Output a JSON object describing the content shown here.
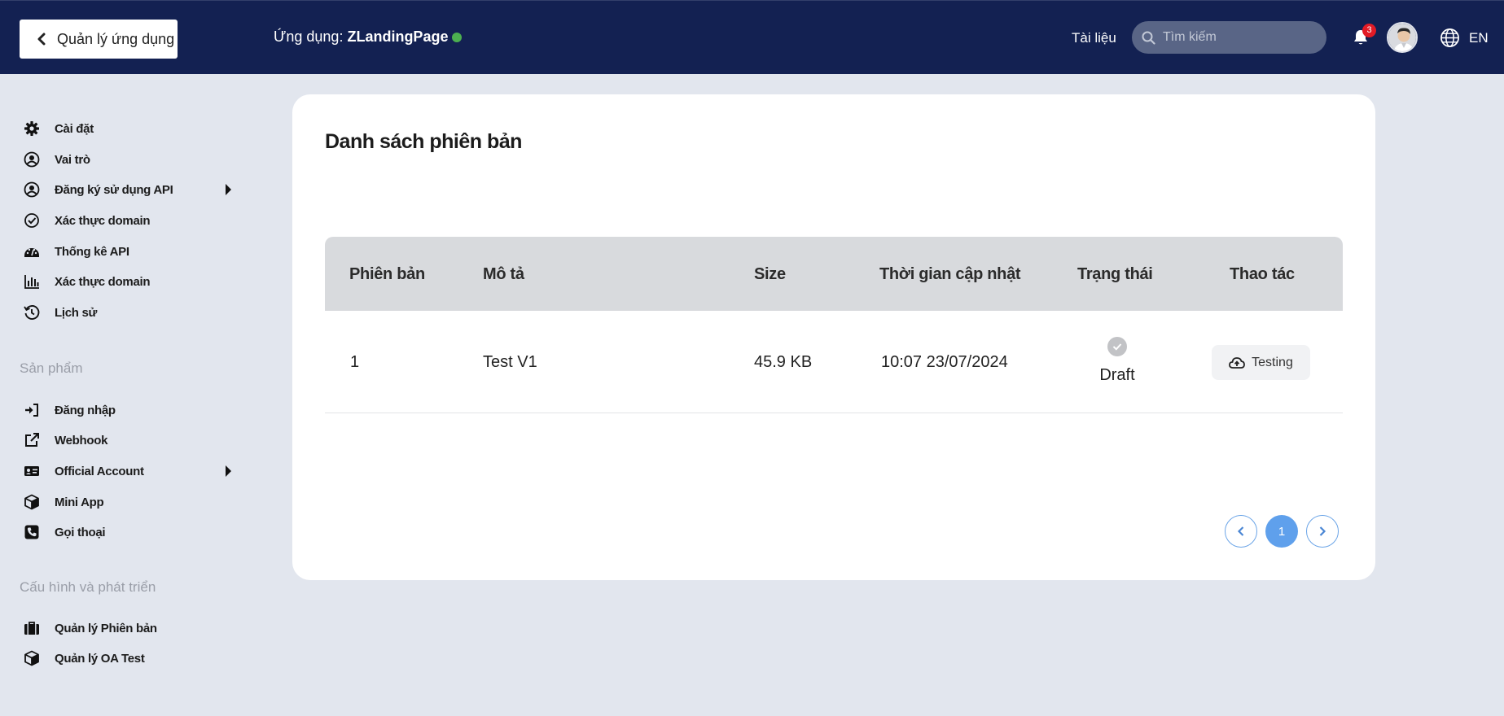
{
  "header": {
    "back_label": "Quản lý ứng dụng",
    "app_prefix": "Ứng dụng:",
    "app_name": "ZLandingPage",
    "app_status_color": "#4caf50",
    "docs_label": "Tài liệu",
    "search_placeholder": "Tìm kiếm",
    "notification_count": "3",
    "language": "EN"
  },
  "sidebar": {
    "items": [
      {
        "label": "Cài đặt",
        "icon": "gear-icon"
      },
      {
        "label": "Vai trò",
        "icon": "user-circle-icon"
      },
      {
        "label": "Đăng ký sử dụng API",
        "icon": "user-circle-icon"
      },
      {
        "label": "Xác thực domain",
        "icon": "check-circle-icon"
      },
      {
        "label": "Thống kê API",
        "icon": "gauge-icon"
      },
      {
        "label": "Xác thực domain",
        "icon": "bar-chart-icon"
      },
      {
        "label": "Lịch sử",
        "icon": "history-icon"
      }
    ],
    "products_title": "Sản phẩm",
    "products": [
      {
        "label": "Đăng nhập",
        "icon": "sign-in-icon"
      },
      {
        "label": "Webhook",
        "icon": "external-link-icon"
      },
      {
        "label": "Official Account",
        "icon": "id-card-icon"
      },
      {
        "label": "Mini App",
        "icon": "cube-icon"
      },
      {
        "label": "Gọi thoại",
        "icon": "phone-icon"
      }
    ],
    "config_title": "Cấu hình và phát triển",
    "config": [
      {
        "label": "Quản lý Phiên bản",
        "icon": "briefcase-icon"
      },
      {
        "label": "Quản lý OA Test",
        "icon": "cube-icon"
      }
    ]
  },
  "main": {
    "title": "Danh sách phiên bản",
    "columns": [
      "Phiên bản",
      "Mô tả",
      "Size",
      "Thời gian cập nhật",
      "Trạng thái",
      "Thao tác"
    ],
    "rows": [
      {
        "version": "1",
        "description": "Test V1",
        "size": "45.9 KB",
        "updated": "10:07 23/07/2024",
        "status": "Draft",
        "action": "Testing"
      }
    ],
    "pagination": {
      "current": "1"
    }
  }
}
